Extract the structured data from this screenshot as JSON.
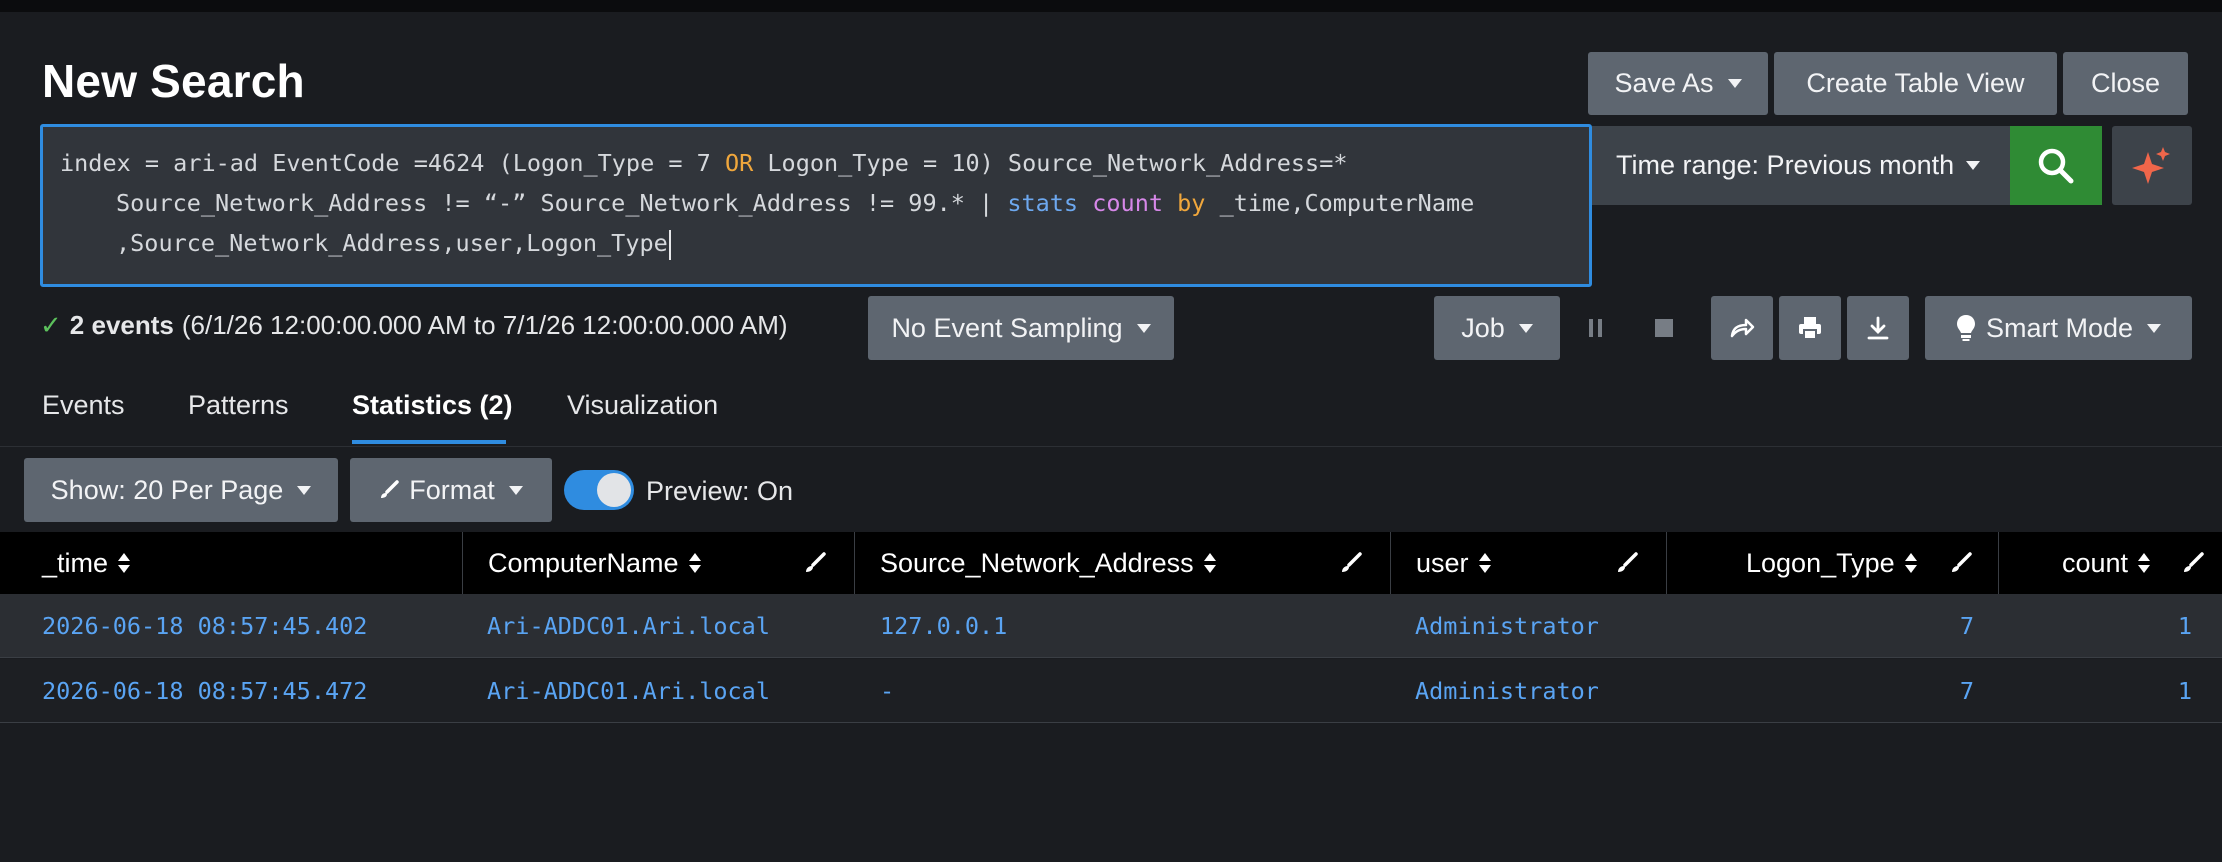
{
  "page": {
    "title": "New Search"
  },
  "header_buttons": {
    "save_as": "Save As",
    "create_table_view": "Create Table View",
    "close": "Close"
  },
  "search": {
    "line1_a": "index = ari-ad EventCode =4624 (Logon_Type = 7 ",
    "line1_or": "OR",
    "line1_b": " Logon_Type = 10) Source_Network_Address=*",
    "line2_a": "Source_Network_Address != “-” Source_Network_Address != 99.* | ",
    "line2_stats": "stats",
    "line2_count": "count",
    "line2_by": "by",
    "line2_b": " _time,ComputerName",
    "line3": ",Source_Network_Address,user,Logon_Type"
  },
  "time_range": {
    "label": "Time range: Previous month"
  },
  "status": {
    "count": "2 events",
    "range": "(6/1/26 12:00:00.000 AM to 7/1/26 12:00:00.000 AM)"
  },
  "controls": {
    "sampling": "No Event Sampling",
    "job": "Job",
    "mode": "Smart Mode"
  },
  "tabs": [
    {
      "label": "Events"
    },
    {
      "label": "Patterns"
    },
    {
      "label": "Statistics (2)"
    },
    {
      "label": "Visualization"
    }
  ],
  "table_controls": {
    "show": "Show: 20 Per Page",
    "format": "Format",
    "preview": "Preview: On"
  },
  "columns": [
    "_time",
    "ComputerName",
    "Source_Network_Address",
    "user",
    "Logon_Type",
    "count"
  ],
  "rows": [
    {
      "time": "2026-06-18 08:57:45.402",
      "computer": "Ari-ADDC01.Ari.local",
      "source": "127.0.0.1",
      "user": "Administrator",
      "logon_type": "7",
      "count": "1"
    },
    {
      "time": "2026-06-18 08:57:45.472",
      "computer": "Ari-ADDC01.Ari.local",
      "source": "-",
      "user": "Administrator",
      "logon_type": "7",
      "count": "1"
    }
  ],
  "colors": {
    "accent": "#2f8ce0",
    "search_button": "#2f8b34",
    "link": "#5aa4f3",
    "success": "#5cc05c"
  }
}
